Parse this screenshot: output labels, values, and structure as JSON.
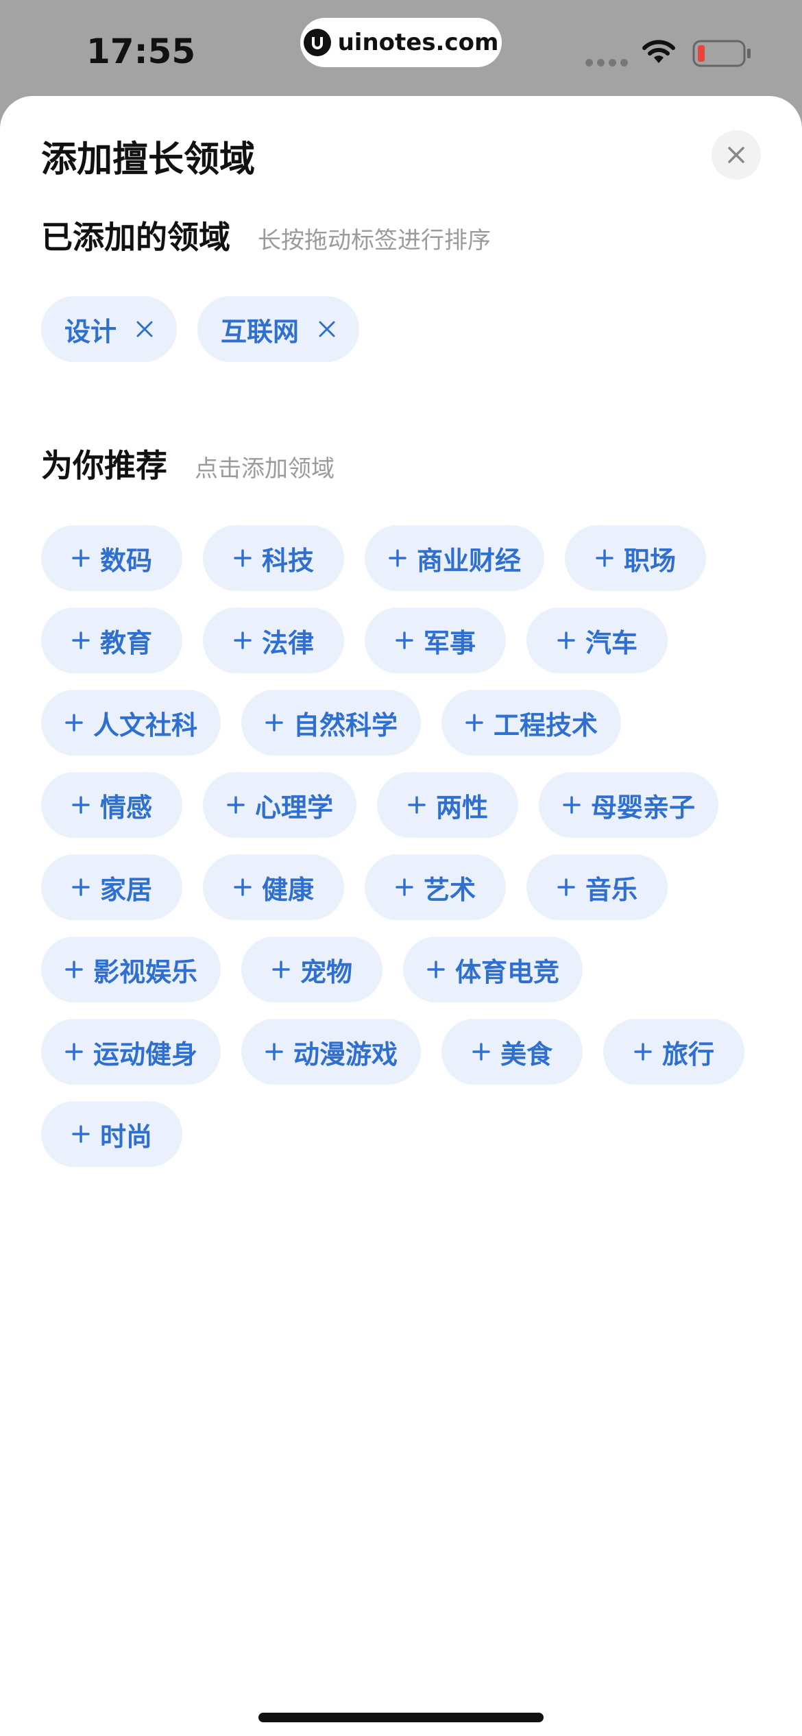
{
  "status_bar": {
    "time": "17:55",
    "url": "uinotes.com",
    "icons": [
      "signal-icon",
      "wifi-icon",
      "battery-icon"
    ]
  },
  "sheet": {
    "title": "添加擅长领域",
    "close_icon": "close-icon"
  },
  "added_section": {
    "title": "已添加的领域",
    "hint": "长按拖动标签进行排序",
    "tags": [
      {
        "label": "设计"
      },
      {
        "label": "互联网"
      }
    ]
  },
  "recommend_section": {
    "title": "为你推荐",
    "hint": "点击添加领域",
    "tags": [
      {
        "label": "数码"
      },
      {
        "label": "科技"
      },
      {
        "label": "商业财经"
      },
      {
        "label": "职场"
      },
      {
        "label": "教育"
      },
      {
        "label": "法律"
      },
      {
        "label": "军事"
      },
      {
        "label": "汽车"
      },
      {
        "label": "人文社科"
      },
      {
        "label": "自然科学"
      },
      {
        "label": "工程技术"
      },
      {
        "label": "情感"
      },
      {
        "label": "心理学"
      },
      {
        "label": "两性"
      },
      {
        "label": "母婴亲子"
      },
      {
        "label": "家居"
      },
      {
        "label": "健康"
      },
      {
        "label": "艺术"
      },
      {
        "label": "音乐"
      },
      {
        "label": "影视娱乐"
      },
      {
        "label": "宠物"
      },
      {
        "label": "体育电竞"
      },
      {
        "label": "运动健身"
      },
      {
        "label": "动漫游戏"
      },
      {
        "label": "美食"
      },
      {
        "label": "旅行"
      },
      {
        "label": "时尚"
      }
    ]
  },
  "colors": {
    "accent": "#2f6fd0",
    "chip_bg": "#eaf1fc",
    "backdrop": "#a3a3a3",
    "battery_low": "#e8453c"
  }
}
